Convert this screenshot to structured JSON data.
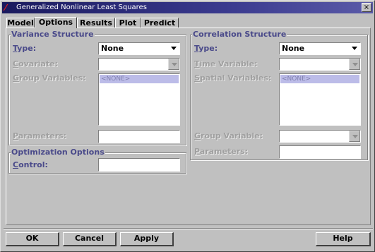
{
  "window": {
    "title": "Generalized Nonlinear Least Squares",
    "close_glyph": "×"
  },
  "tabs": [
    {
      "label": "Model",
      "active": false
    },
    {
      "label": "Options",
      "active": true
    },
    {
      "label": "Results",
      "active": false
    },
    {
      "label": "Plot",
      "active": false
    },
    {
      "label": "Predict",
      "active": false
    }
  ],
  "variance": {
    "legend": "Variance Structure",
    "type_label_u": "T",
    "type_label_rest": "ype:",
    "type_value": "None",
    "covariate_label_u": "C",
    "covariate_label_rest": "ovariate:",
    "group_vars_label_u": "G",
    "group_vars_label_rest": "roup Variables:",
    "group_vars_item": "<NONE>",
    "parameters_label_u": "P",
    "parameters_label_rest": "arameters:"
  },
  "optimization": {
    "legend": "Optimization Options",
    "control_label_rest": "ontrol:",
    "control_label_u": "C"
  },
  "correlation": {
    "legend": "Correlation Structure",
    "type_label_u": "T",
    "type_label_rest": "ype:",
    "type_value": "None",
    "time_var_label_u": "T",
    "time_var_label_rest": "ime Variable:",
    "spatial_vars_label_u": "S",
    "spatial_vars_label_rest": "patial Variables:",
    "spatial_vars_item": "<NONE>",
    "group_var_label_u": "G",
    "group_var_label_rest": "roup Variable:",
    "parameters_label_u": "P",
    "parameters_label_rest": "arameters:"
  },
  "buttons": {
    "ok": "OK",
    "cancel": "Cancel",
    "apply": "Apply",
    "help": "Help"
  },
  "colors": {
    "title_bar": "#1a1a5e",
    "label_text": "#4a4a8a",
    "list_selection": "#bcbce8"
  }
}
